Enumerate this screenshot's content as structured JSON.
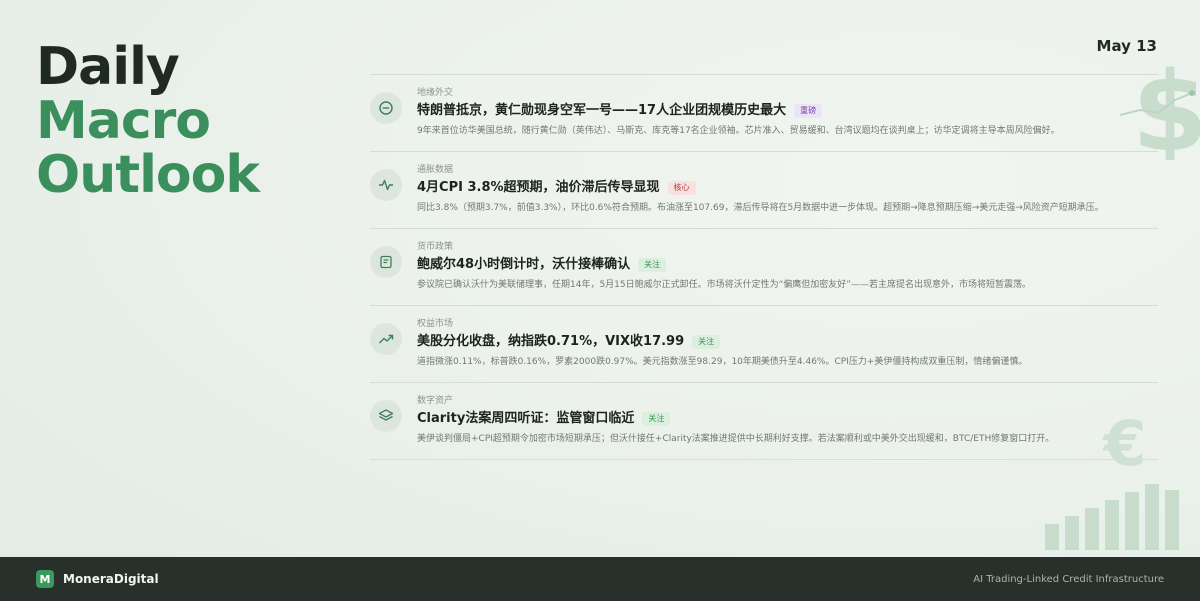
{
  "title": {
    "line1": "Daily",
    "line2": "Macro",
    "line3": "Outlook"
  },
  "date": "May 13",
  "items": [
    {
      "category": "地缘外交",
      "icon": "minus-circle-icon",
      "headline": "特朗普抵京，黄仁勋现身空军一号——17人企业团规模历史最大",
      "badge": "重磅",
      "badge_color": "#7a46a8",
      "description": "9年来首位访华美国总统，随行黄仁勋（英伟达）、马斯克、库克等17名企业领袖。芯片准入、贸易缓和、台湾议题均在谈判桌上；访华定调将主导本周风险偏好。"
    },
    {
      "category": "通胀数据",
      "icon": "pulse-icon",
      "headline": "4月CPI 3.8%超预期，油价滞后传导显现",
      "badge": "核心",
      "badge_color": "#b03a34",
      "description": "同比3.8%（预期3.7%，前值3.3%），环比0.6%符合预期。布油涨至107.69，滞后传导将在5月数据中进一步体现。超预期→降息预期压缩→美元走强→风险资产短期承压。"
    },
    {
      "category": "货币政策",
      "icon": "document-icon",
      "headline": "鲍威尔48小时倒计时，沃什接棒确认",
      "badge": "关注",
      "badge_color": "#3f8e55",
      "description": "参议院已确认沃什为美联储理事，任期14年，5月15日鲍威尔正式卸任。市场将沃什定性为“偏鹰但加密友好”——若主席提名出现意外，市场将短暂震荡。"
    },
    {
      "category": "权益市场",
      "icon": "trending-up-icon",
      "headline": "美股分化收盘，纳指跌0.71%，VIX收17.99",
      "badge": "关注",
      "badge_color": "#3f8e55",
      "description": "道指微涨0.11%，标普跌0.16%，罗素2000跌0.97%。美元指数涨至98.29，10年期美债升至4.46%。CPI压力+美伊僵持构成双重压制，情绪偏谨慎。"
    },
    {
      "category": "数字资产",
      "icon": "layers-icon",
      "headline": "Clarity法案周四听证：监管窗口临近",
      "badge": "关注",
      "badge_color": "#3f8e55",
      "description": "美伊谈判僵局+CPI超预期令加密市场短期承压；但沃什接任+Clarity法案推进提供中长期利好支撑。若法案顺利或中美外交出现缓和，BTC/ETH修复窗口打开。"
    }
  ],
  "footer": {
    "logo_letter": "M",
    "brand": "MoneraDigital",
    "tagline": "AI Trading-Linked Credit Infrastructure"
  },
  "colors": {
    "accent": "#3a8f5c",
    "footer_bg": "#27302a"
  }
}
